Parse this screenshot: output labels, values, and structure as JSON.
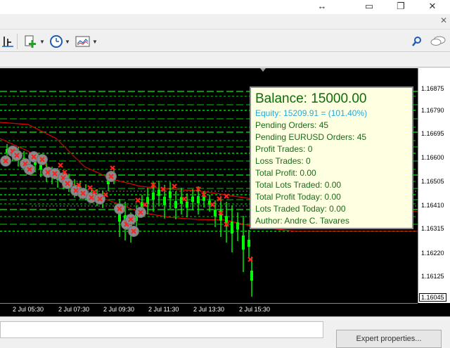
{
  "window": {
    "resize_icon": "↔",
    "minimize_icon": "▭",
    "restore_icon": "❐",
    "close_icon": "✕"
  },
  "subwindow": {
    "close_icon": "✕"
  },
  "toolbar": {
    "icons": [
      "chart-bars-icon",
      "add-indicator-icon",
      "period-clock-icon",
      "template-icon",
      "search-icon",
      "chat-icon"
    ]
  },
  "chart": {
    "price_labels": [
      "1.16875",
      "1.16790",
      "1.16695",
      "1.16600",
      "1.16505",
      "1.16410",
      "1.16315",
      "1.16220",
      "1.16125"
    ],
    "current_price": "1.16045",
    "time_labels": [
      "2 Jul 05:30",
      "2 Jul 07:30",
      "2 Jul 09:30",
      "2 Jul 11:30",
      "2 Jul 13:30",
      "2 Jul 15:30"
    ],
    "colors": {
      "candle": "#00ff00",
      "order": "#ff2020",
      "grid_line": "#00d000",
      "band": "#e00000"
    }
  },
  "info_panel": {
    "balance": "Balance: 15000.00",
    "equity": "Equity: 15209.91 = (101.40%)",
    "pending_orders": "Pending Orders: 45",
    "pending_eurusd": "Pending EURUSD Orders: 45",
    "profit_trades": "Profit Trades: 0",
    "loss_trades": "Loss Trades: 0",
    "total_profit": "Total Profit: 0.00",
    "total_lots": "Total Lots Traded: 0.00",
    "profit_today": "Total Profit Today: 0.00",
    "lots_today": "Lots Traded Today: 0.00",
    "author": "Author: Andre C. Tavares"
  },
  "bottom": {
    "expert_properties": "Expert properties..."
  }
}
